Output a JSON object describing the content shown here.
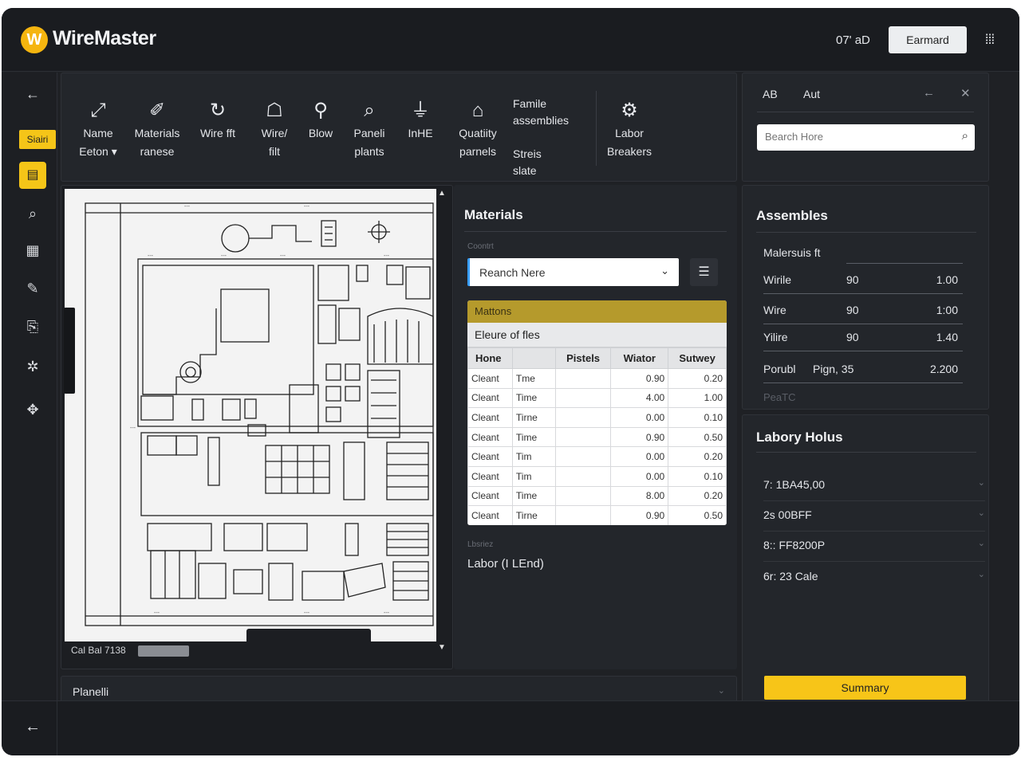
{
  "app": {
    "name": "WireMaster",
    "logo_letter": "W",
    "status": "07' aD",
    "top_button": "Earmard",
    "menu_icon": "grid-menu-icon"
  },
  "rail": {
    "tag": "Siairi"
  },
  "toolbar": {
    "tools": [
      {
        "icon": "resize-icon",
        "label": "Name\nEeton ▾"
      },
      {
        "icon": "ruler-icon",
        "label": "Materials\nranese"
      },
      {
        "icon": "cycle-icon",
        "label": "Wire fft"
      },
      {
        "icon": "person-icon",
        "label": "Wire/\nfilt"
      },
      {
        "icon": "blow-icon",
        "label": "Blow"
      },
      {
        "icon": "search-tool-icon",
        "label": "Paneli\nplants"
      },
      {
        "icon": "connector-icon",
        "label": "InHE"
      },
      {
        "icon": "home-icon",
        "label": "Quatiity\nparnels"
      },
      {
        "icon": "gear-icon",
        "label": "Labor\nBreakers"
      }
    ],
    "famile_label": "Famile\nassemblies\n\nStreis\nslate"
  },
  "sidebar": {
    "tab_a": "AB",
    "tab_b": "Aut",
    "search_placeholder": "Bearch Hore"
  },
  "drawing": {
    "footer": "Cal  Bal 7138"
  },
  "materials": {
    "title": "Materials",
    "small_label": "Coontrt",
    "select_value": "Reanch Nere",
    "table_header": "Mattons",
    "table_subheader": "Eleure of fles",
    "columns": [
      "Hone",
      "",
      "Pistels",
      "Wiator",
      "Sutwey"
    ],
    "rows": [
      [
        "Cleant",
        "Tme",
        "",
        "0.90",
        "0.20"
      ],
      [
        "Cleant",
        "Time",
        "",
        "4.00",
        "1.00"
      ],
      [
        "Cleant",
        "Tirne",
        "",
        "0.00",
        "0.10"
      ],
      [
        "Cleant",
        "Time",
        "",
        "0.90",
        "0.50"
      ],
      [
        "Cleant",
        "Tim",
        "",
        "0.00",
        "0.20"
      ],
      [
        "Cleant",
        "Tim",
        "",
        "0.00",
        "0.10"
      ],
      [
        "Cleant",
        "Time",
        "",
        "8.00",
        "0.20"
      ],
      [
        "Cleant",
        "Tirne",
        "",
        "0.90",
        "0.50"
      ]
    ],
    "labor_small": "Lbsriez",
    "labor_line": "Labor (I LEnd)"
  },
  "assemblies": {
    "title": "Assembles",
    "header": "Malersuis ft",
    "rows": [
      {
        "name": "Wirile",
        "col2": "90",
        "value": "1.00"
      },
      {
        "name": "Wire",
        "col2": "90",
        "value": "1:00"
      },
      {
        "name": "Yilire",
        "col2": "90",
        "value": "1.40"
      },
      {
        "name": "Porubl",
        "col2": "Pign,  35",
        "value": "2.200"
      }
    ],
    "footer": "PeaTC"
  },
  "labor": {
    "title": "Labory Holus",
    "rows": [
      "7: 1BA45,00",
      "2s 00BFF",
      "8:: FF8200P",
      "6r: 23 Cale"
    ],
    "summary_button": "Summary"
  },
  "bottom_panel": {
    "label": "Planelli"
  }
}
